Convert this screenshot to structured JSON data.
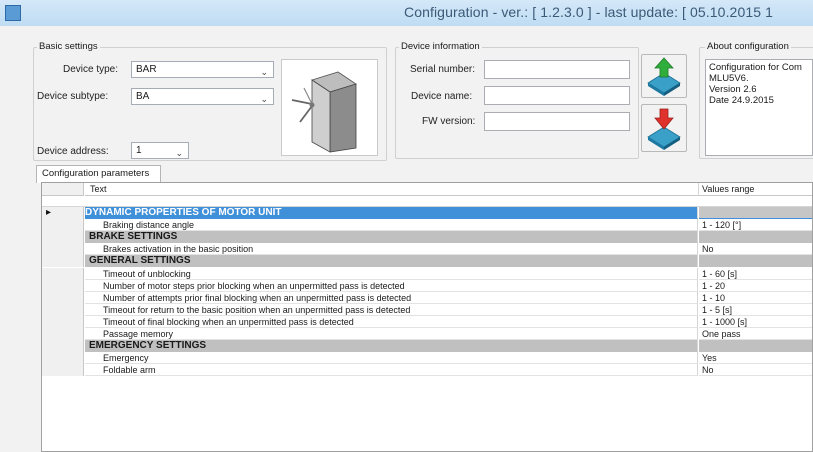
{
  "window": {
    "title": "Configuration - ver.: [ 1.2.3.0 ] - last update: [ 05.10.2015  1"
  },
  "basic_settings": {
    "group_label": "Basic settings",
    "device_type_label": "Device type:",
    "device_type_value": "BAR",
    "device_subtype_label": "Device subtype:",
    "device_subtype_value": "BA",
    "device_address_label": "Device address:",
    "device_address_value": "1"
  },
  "device_information": {
    "group_label": "Device information",
    "serial_number_label": "Serial number:",
    "device_name_label": "Device name:",
    "fw_version_label": "FW version:"
  },
  "about": {
    "group_label": "About configuration",
    "text": "Configuration for Com\nMLU5V6.\nVersion 2.6\nDate 24.9.2015"
  },
  "tabs": {
    "configuration_parameters": "Configuration parameters"
  },
  "grid": {
    "columns": {
      "text": "Text",
      "values_range": "Values range"
    },
    "rows": [
      {
        "kind": "selected",
        "text": "DYNAMIC PROPERTIES OF MOTOR UNIT",
        "value": ""
      },
      {
        "kind": "item",
        "text": "Braking distance angle",
        "value": "1 - 120 [°]"
      },
      {
        "kind": "section",
        "text": "BRAKE SETTINGS",
        "value": ""
      },
      {
        "kind": "item",
        "text": "Brakes activation in the basic position",
        "value": "No"
      },
      {
        "kind": "section",
        "text": "GENERAL SETTINGS",
        "value": ""
      },
      {
        "kind": "item",
        "text": "Timeout of unblocking",
        "value": "1 - 60 [s]"
      },
      {
        "kind": "item",
        "text": "Number of motor steps prior blocking when an unpermitted pass is detected",
        "value": "1 - 20"
      },
      {
        "kind": "item",
        "text": "Number of attempts prior final blocking when an unpermitted pass is detected",
        "value": "1 - 10"
      },
      {
        "kind": "item",
        "text": "Timeout for return to the basic position when an unpermitted pass is detected",
        "value": "1 - 5 [s]"
      },
      {
        "kind": "item",
        "text": "Timeout of final blocking when an unpermitted pass is detected",
        "value": "1 - 1000 [s]"
      },
      {
        "kind": "item",
        "text": "Passage memory",
        "value": "One pass"
      },
      {
        "kind": "section",
        "text": "EMERGENCY SETTINGS",
        "value": ""
      },
      {
        "kind": "item",
        "text": "Emergency",
        "value": "Yes"
      },
      {
        "kind": "item",
        "text": "Foldable arm",
        "value": "No"
      }
    ]
  },
  "icons": {
    "upload": "upload-arrow-icon",
    "download": "download-arrow-icon",
    "turnstile": "turnstile-image"
  },
  "colors": {
    "selection": "#3f8fd9",
    "section_band": "#c0c0c0",
    "upload_arrow": "#2fae3c",
    "download_arrow": "#e0322c"
  }
}
